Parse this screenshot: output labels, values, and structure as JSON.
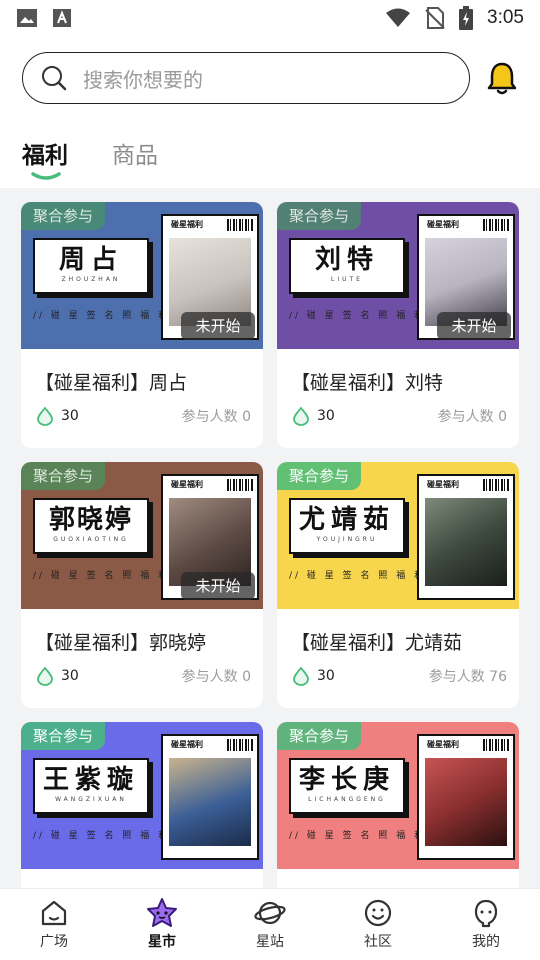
{
  "status_bar": {
    "time": "3:05",
    "icons": [
      "image-icon",
      "font-download-icon",
      "wifi-icon",
      "no-sim-icon",
      "battery-charging-icon"
    ]
  },
  "search": {
    "placeholder": "搜索你想要的"
  },
  "tabs": [
    {
      "label": "福利",
      "active": true
    },
    {
      "label": "商品",
      "active": false
    }
  ],
  "cards": [
    {
      "tag": "聚合参与",
      "name": "周占",
      "pinyin": "ZHOUZHAN",
      "welfare_line": "// 碰 星 签 名 照 福 利 //",
      "photo_title": "碰星福利",
      "status": "未开始",
      "title": "【碰星福利】周占",
      "price": "30",
      "participants": "参与人数 0",
      "bg": "#4e6fae",
      "photo_fill": "#c9c3bf"
    },
    {
      "tag": "聚合参与",
      "name": "刘特",
      "pinyin": "LIUTE",
      "welfare_line": "// 碰 星 签 名 照 福 利 //",
      "photo_title": "碰星福利",
      "status": "未开始",
      "title": "【碰星福利】刘特",
      "price": "30",
      "participants": "参与人数 0",
      "bg": "#6f4ea6",
      "photo_fill": "#b8b4c0"
    },
    {
      "tag": "聚合参与",
      "name": "郭晓婷",
      "pinyin": "GUOXIAOTING",
      "welfare_line": "// 碰 星 签 名 照 福 利 //",
      "photo_title": "碰星福利",
      "status": "未开始",
      "title": "【碰星福利】郭晓婷",
      "price": "30",
      "participants": "参与人数 0",
      "bg": "#8a5a46",
      "photo_fill": "#5d4a44"
    },
    {
      "tag": "聚合参与",
      "name": "尤靖茹",
      "pinyin": "YOUJINGRU",
      "welfare_line": "// 碰 星 签 名 照 福 利 //",
      "photo_title": "碰星福利",
      "status": "",
      "title": "【碰星福利】尤靖茹",
      "price": "30",
      "participants": "参与人数 76",
      "bg": "#f7d64e",
      "photo_fill": "#3f4a40"
    },
    {
      "tag": "聚合参与",
      "name": "王紫璇",
      "pinyin": "WANGZIXUAN",
      "welfare_line": "// 碰 星 签 名 照 福 利 //",
      "photo_title": "碰星福利",
      "status": "",
      "title": "",
      "price": "",
      "participants": "",
      "bg": "#6a6be8",
      "photo_fill": "#3a5e96"
    },
    {
      "tag": "聚合参与",
      "name": "李长庚",
      "pinyin": "LICHANGGENG",
      "welfare_line": "// 碰 星 签 名 照 福 利 //",
      "photo_title": "碰星福利",
      "status": "",
      "title": "",
      "price": "",
      "participants": "",
      "bg": "#f08080",
      "photo_fill": "#8b2f2f"
    }
  ],
  "bottom_nav": [
    {
      "label": "广场",
      "icon": "home-icon",
      "active": false
    },
    {
      "label": "星市",
      "icon": "star-market-icon",
      "active": true
    },
    {
      "label": "星站",
      "icon": "planet-icon",
      "active": false
    },
    {
      "label": "社区",
      "icon": "community-face-icon",
      "active": false
    },
    {
      "label": "我的",
      "icon": "profile-icon",
      "active": false
    }
  ],
  "colors": {
    "accent_green": "#48bc7d",
    "accent_purple": "#7b3fe4",
    "bell_yellow": "#f5c518"
  }
}
